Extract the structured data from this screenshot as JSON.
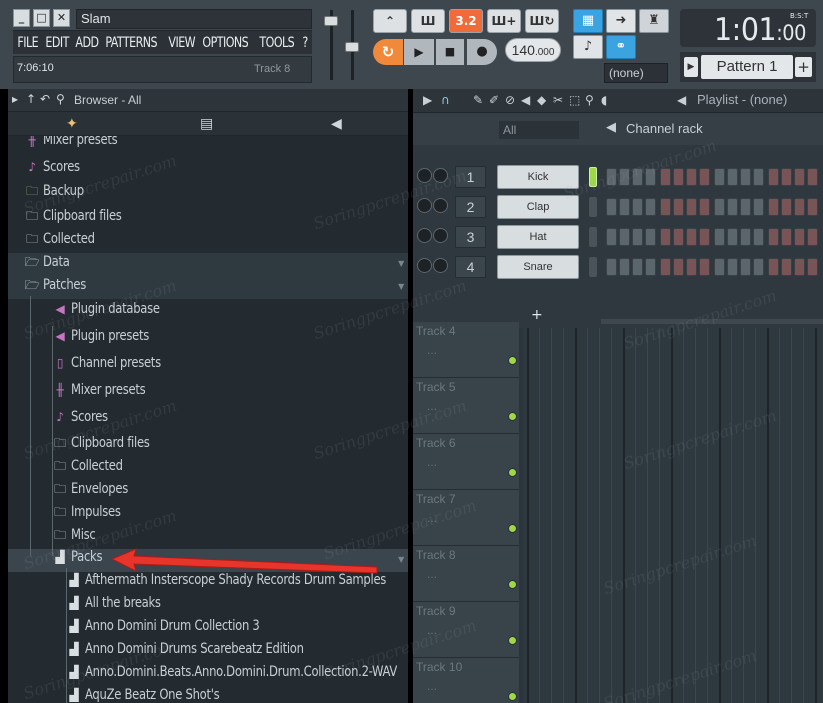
{
  "window": {
    "title": "Slam",
    "time_hint": "7:06:10",
    "track_hint": "Track 8"
  },
  "menu": [
    "FILE",
    "EDIT",
    "ADD",
    "PATTERNS",
    "VIEW",
    "OPTIONS",
    "TOOLS",
    "?"
  ],
  "transport": {
    "tempo_main": "140",
    "tempo_frac": ".000",
    "cpu_display": "3.2",
    "clock_main": "1:01",
    "clock_sub": ":00",
    "clock_unit": "B:S:T",
    "none_select": "(none)",
    "pattern_name": "Pattern 1",
    "pattern_add": "+"
  },
  "browser": {
    "title": "Browser - All",
    "items": [
      {
        "label": "Mixer presets",
        "icon": "mixer-icon",
        "glyph": "╫",
        "color": "mag",
        "indent": 0
      },
      {
        "label": "Scores",
        "icon": "note-icon",
        "glyph": "♪",
        "color": "mag",
        "indent": 0
      },
      {
        "label": "Backup",
        "icon": "folder-icon",
        "glyph": "🗀",
        "color": "grn",
        "indent": 0
      },
      {
        "label": "Clipboard files",
        "icon": "folder-icon",
        "glyph": "🗀",
        "color": "wht",
        "indent": 0
      },
      {
        "label": "Collected",
        "icon": "folder-icon",
        "glyph": "🗀",
        "color": "wht",
        "indent": 0
      },
      {
        "label": "Data",
        "icon": "folder-open-icon",
        "glyph": "🗁",
        "color": "wht",
        "indent": 0
      },
      {
        "label": "Patches",
        "icon": "folder-open-icon",
        "glyph": "🗁",
        "color": "wht",
        "indent": 1
      },
      {
        "label": "Plugin database",
        "icon": "plugin-icon",
        "glyph": "◀",
        "color": "mag",
        "indent": 2
      },
      {
        "label": "Plugin presets",
        "icon": "plugin-icon",
        "glyph": "◀",
        "color": "mag",
        "indent": 2
      },
      {
        "label": "Channel presets",
        "icon": "channel-icon",
        "glyph": "▯",
        "color": "mag",
        "indent": 2
      },
      {
        "label": "Mixer presets",
        "icon": "mixer-icon",
        "glyph": "╫",
        "color": "mag",
        "indent": 2
      },
      {
        "label": "Scores",
        "icon": "note-icon",
        "glyph": "♪",
        "color": "mag",
        "indent": 2
      },
      {
        "label": "Clipboard files",
        "icon": "folder-icon",
        "glyph": "🗀",
        "color": "wht",
        "indent": 2
      },
      {
        "label": "Collected",
        "icon": "folder-icon",
        "glyph": "🗀",
        "color": "wht",
        "indent": 2
      },
      {
        "label": "Envelopes",
        "icon": "folder-icon",
        "glyph": "🗀",
        "color": "wht",
        "indent": 2
      },
      {
        "label": "Impulses",
        "icon": "folder-icon",
        "glyph": "🗀",
        "color": "wht",
        "indent": 2
      },
      {
        "label": "Misc",
        "icon": "folder-icon",
        "glyph": "🗀",
        "color": "wht",
        "indent": 2
      },
      {
        "label": "Packs",
        "icon": "pack-icon",
        "glyph": "▟",
        "color": "wht",
        "indent": 2
      },
      {
        "label": "Afthermath Insterscope Shady Records Drum Samples",
        "icon": "pack-icon",
        "glyph": "▟",
        "color": "wht",
        "indent": 3
      },
      {
        "label": "All the breaks",
        "icon": "pack-icon",
        "glyph": "▟",
        "color": "wht",
        "indent": 3
      },
      {
        "label": "Anno Domini Drum Collection 3",
        "icon": "pack-icon",
        "glyph": "▟",
        "color": "wht",
        "indent": 3
      },
      {
        "label": "Anno Domini Drums Scarebeatz Edition",
        "icon": "pack-icon",
        "glyph": "▟",
        "color": "wht",
        "indent": 3
      },
      {
        "label": "Anno.Domini.Beats.Anno.Domini.Drum.Collection.2-WAV",
        "icon": "pack-icon",
        "glyph": "▟",
        "color": "wht",
        "indent": 3
      },
      {
        "label": "AquZe Beatz One Shot's",
        "icon": "pack-icon",
        "glyph": "▟",
        "color": "wht",
        "indent": 3
      }
    ]
  },
  "playlist": {
    "title": "Playlist - (none)"
  },
  "channel_rack": {
    "filter": "All",
    "title": "Channel rack",
    "add_label": "+",
    "channels": [
      {
        "num": "1",
        "name": "Kick"
      },
      {
        "num": "2",
        "name": "Clap"
      },
      {
        "num": "3",
        "name": "Hat"
      },
      {
        "num": "4",
        "name": "Snare"
      }
    ]
  },
  "tracks": [
    "Track 4",
    "Track 5",
    "Track 6",
    "Track 7",
    "Track 8",
    "Track 9",
    "Track 10"
  ],
  "watermark": "Soringpcrepair.com"
}
